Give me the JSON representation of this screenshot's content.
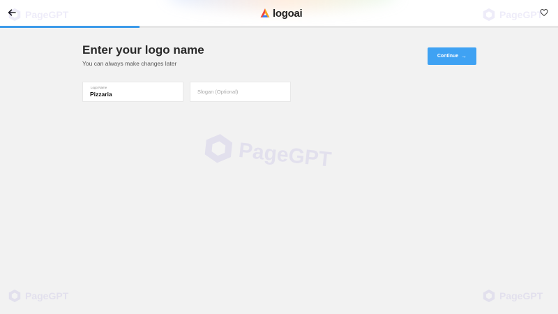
{
  "header": {
    "logo_text": "logoai",
    "progress_fraction": 0.25
  },
  "icons": {
    "back": "arrow-left-icon",
    "favorite": "heart-icon",
    "continue": "arrow-right-icon"
  },
  "page": {
    "title": "Enter your logo name",
    "subtitle": "You can always make changes later"
  },
  "actions": {
    "continue_label": "Continue"
  },
  "form": {
    "logo_name": {
      "label": "Logo Name",
      "value": "Pizzaria"
    },
    "slogan": {
      "placeholder": "Slogan (Optional)",
      "value": ""
    }
  },
  "watermark": {
    "text": "PageGPT"
  },
  "colors": {
    "accent": "#3fa2f3",
    "background": "#f2f2f2"
  }
}
